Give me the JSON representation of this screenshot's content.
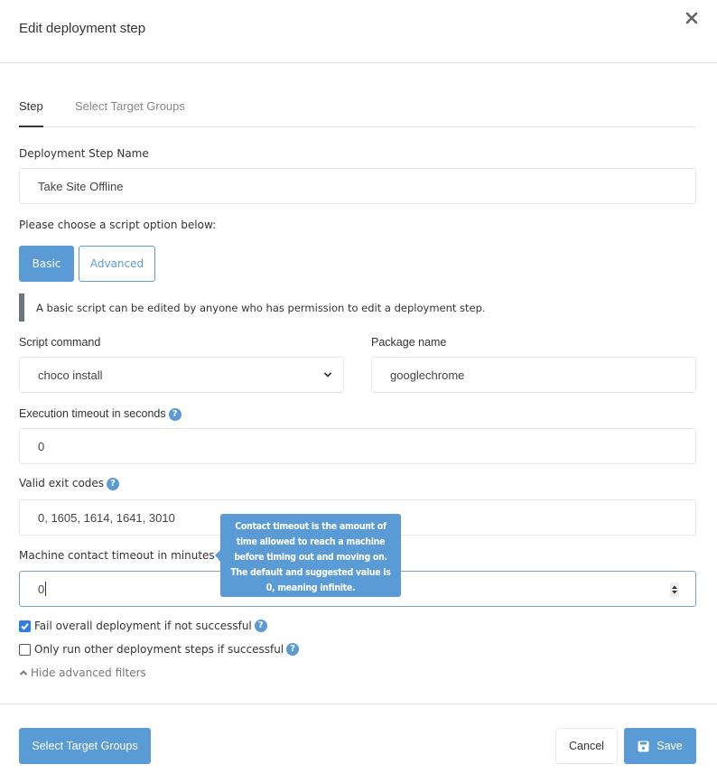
{
  "dialog": {
    "title": "Edit deployment step",
    "close_icon": "close-icon"
  },
  "tabs": [
    {
      "label": "Step",
      "active": true
    },
    {
      "label": "Select Target Groups",
      "active": false
    }
  ],
  "form": {
    "step_name": {
      "label": "Deployment Step Name",
      "value": "Take Site Offline"
    },
    "script_option": {
      "prompt": "Please choose a script option below:",
      "options": [
        {
          "label": "Basic",
          "selected": true
        },
        {
          "label": "Advanced",
          "selected": false
        }
      ],
      "note": "A basic script can be edited by anyone who has permission to edit a deployment step."
    },
    "script_command": {
      "label": "Script command",
      "value": "choco install"
    },
    "package_name": {
      "label": "Package name",
      "value": "googlechrome"
    },
    "execution_timeout": {
      "label": "Execution timeout in seconds",
      "value": "0",
      "help_icon": "question-circle-icon"
    },
    "valid_exit_codes": {
      "label": "Valid exit codes",
      "value": "0, 1605, 1614, 1641, 3010",
      "help_icon": "question-circle-icon"
    },
    "machine_contact_timeout": {
      "label": "Machine contact timeout in minutes",
      "value": "0",
      "help_icon": "question-circle-icon"
    },
    "tooltip": "Contact timeout is the amount of time allowed to reach a machine before timing out and moving on. The default and suggested value is 0, meaning infinite.",
    "fail_overall": {
      "label": "Fail overall deployment if not successful",
      "checked": true
    },
    "only_run_if_successful": {
      "label": "Only run other deployment steps if successful",
      "checked": false
    },
    "toggle_filters": "Hide advanced filters"
  },
  "footer": {
    "select_target_groups": "Select Target Groups",
    "cancel": "Cancel",
    "save": "Save"
  },
  "colors": {
    "primary": "#5b9bd5",
    "checkbox": "#2b7de9",
    "note_bar": "#6c757d"
  }
}
